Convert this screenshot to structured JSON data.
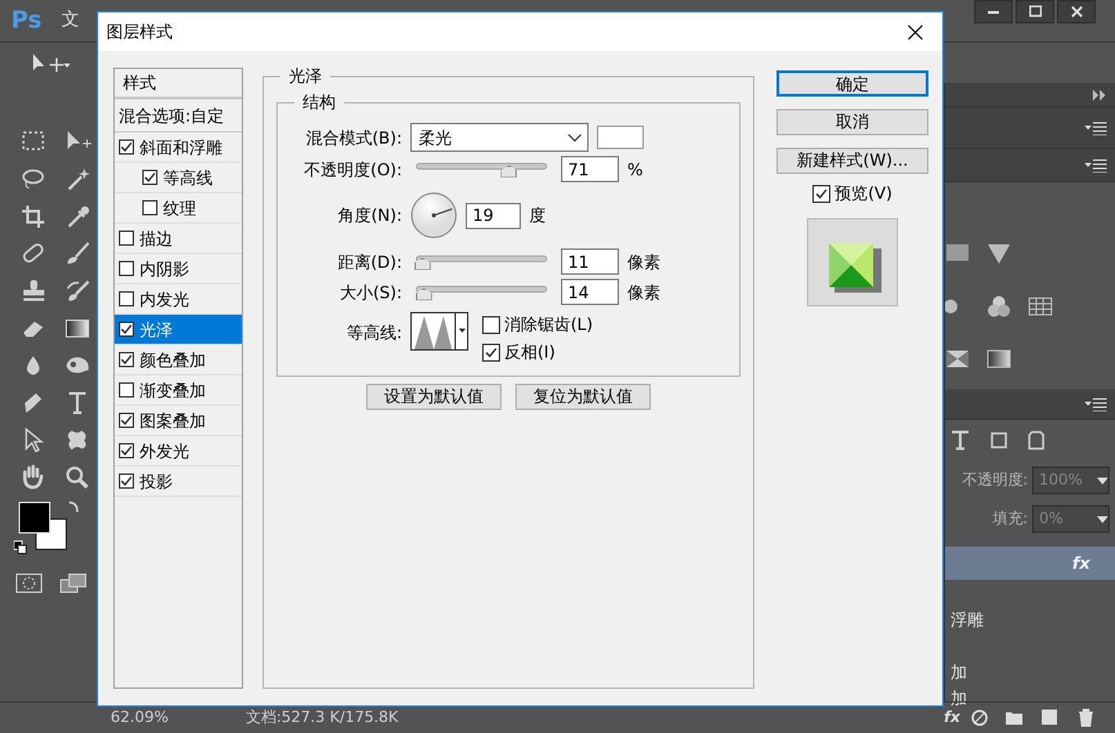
{
  "app": {
    "logo": "Ps",
    "menu": [
      "文"
    ]
  },
  "layers_panel": {
    "opacity_label": "不透明度:",
    "opacity_value": "100%",
    "fill_label": "填充:",
    "fill_value": "0%",
    "layer_fx": "fx",
    "effects": [
      "浮雕",
      "加",
      "加"
    ],
    "footer_fx": "fx"
  },
  "status_bar": {
    "zoom": "62.09%",
    "doc_info": "文档:527.3 K/175.8K"
  },
  "dialog": {
    "title": "图层样式",
    "styles_header": "样式",
    "blending_options": "混合选项:自定",
    "styles": [
      {
        "label": "斜面和浮雕",
        "checked": true,
        "selected": false,
        "children": [
          {
            "label": "等高线",
            "checked": true,
            "selected": false
          },
          {
            "label": "纹理",
            "checked": false,
            "selected": false
          }
        ]
      },
      {
        "label": "描边",
        "checked": false,
        "selected": false
      },
      {
        "label": "内阴影",
        "checked": false,
        "selected": false
      },
      {
        "label": "内发光",
        "checked": false,
        "selected": false
      },
      {
        "label": "光泽",
        "checked": true,
        "selected": true
      },
      {
        "label": "颜色叠加",
        "checked": true,
        "selected": false
      },
      {
        "label": "渐变叠加",
        "checked": false,
        "selected": false
      },
      {
        "label": "图案叠加",
        "checked": true,
        "selected": false
      },
      {
        "label": "外发光",
        "checked": true,
        "selected": false
      },
      {
        "label": "投影",
        "checked": true,
        "selected": false
      }
    ],
    "section_title": "光泽",
    "group_title": "结构",
    "blend_mode": {
      "label": "混合模式(B):",
      "value": "柔光",
      "color": "#ffffff"
    },
    "opacity": {
      "label": "不透明度(O):",
      "level": 0.71,
      "value": "71",
      "unit": "%"
    },
    "angle": {
      "label": "角度(N):",
      "value": "19",
      "unit": "度"
    },
    "distance": {
      "label": "距离(D):",
      "level": 0.05,
      "value": "11",
      "unit": "像素"
    },
    "size": {
      "label": "大小(S):",
      "level": 0.06,
      "value": "14",
      "unit": "像素"
    },
    "contour": {
      "label": "等高线:"
    },
    "anti_alias": {
      "label": "消除锯齿(L)",
      "checked": false
    },
    "invert": {
      "label": "反相(I)",
      "checked": true
    },
    "default_buttons": [
      "设置为默认值",
      "复位为默认值"
    ],
    "buttons": [
      {
        "label": "确定",
        "default": true
      },
      {
        "label": "取消",
        "default": false
      },
      {
        "label": "新建样式(W)...",
        "default": false
      }
    ],
    "preview": {
      "label": "预览(V)",
      "checked": true
    }
  }
}
